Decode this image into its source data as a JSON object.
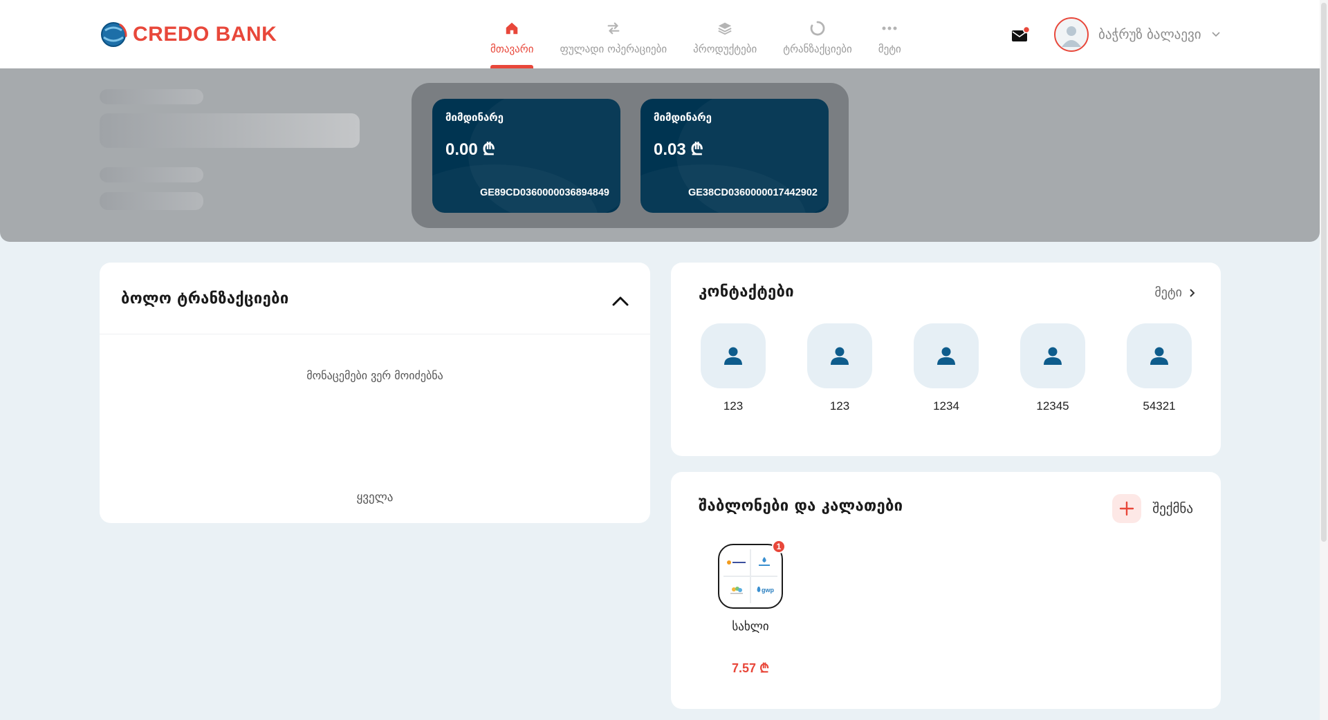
{
  "brand": {
    "name": "CREDO BANK",
    "accent": "#e8473a",
    "dark": "#003451"
  },
  "nav": {
    "items": [
      {
        "label": "მთავარი",
        "icon": "home-icon",
        "active": true
      },
      {
        "label": "ფულადი ოპერაციები",
        "icon": "transfer-arrows-icon",
        "active": false
      },
      {
        "label": "პროდუქტები",
        "icon": "layers-icon",
        "active": false
      },
      {
        "label": "ტრანზაქციები",
        "icon": "circle-progress-icon",
        "active": false
      },
      {
        "label": "მეტი",
        "icon": "more-dots-icon",
        "active": false
      }
    ]
  },
  "header": {
    "mail_icon": "envelope-icon",
    "user_name": "ბაჭრუზ ბალაევი"
  },
  "accounts": [
    {
      "type": "მიმდინარე",
      "balance": "0.00 ₾",
      "iban": "GE89CD0360000036894849"
    },
    {
      "type": "მიმდინარე",
      "balance": "0.03 ₾",
      "iban": "GE38CD0360000017442902"
    }
  ],
  "transactions": {
    "title": "ბოლო ტრანზაქციები",
    "empty_text": "მონაცემები ვერ მოიძებნა",
    "all_label": "ყველა"
  },
  "contacts": {
    "title": "კონტაქტები",
    "more_label": "მეტი",
    "items": [
      {
        "name": "123"
      },
      {
        "name": "123"
      },
      {
        "name": "1234"
      },
      {
        "name": "12345"
      },
      {
        "name": "54321"
      }
    ]
  },
  "templates": {
    "title": "შაბლონები და კალათები",
    "create_label": "შექმნა",
    "baskets": [
      {
        "name": "სახლი",
        "amount": "7.57 ₾",
        "badge": "1"
      }
    ]
  }
}
